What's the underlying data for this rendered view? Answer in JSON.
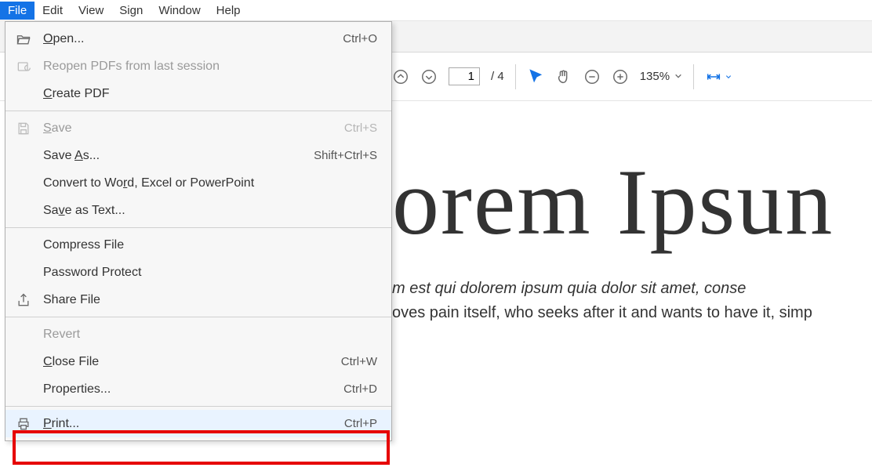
{
  "menubar": {
    "file": "File",
    "edit": "Edit",
    "view": "View",
    "sign": "Sign",
    "window": "Window",
    "help": "Help"
  },
  "toolbar": {
    "page_current": "1",
    "page_total": "/ 4",
    "zoom_label": "135%"
  },
  "file_menu": {
    "open": {
      "label": "Open...",
      "shortcut": "Ctrl+O"
    },
    "reopen": {
      "label": "Reopen PDFs from last session",
      "shortcut": ""
    },
    "create_pdf": {
      "label": "Create PDF",
      "shortcut": ""
    },
    "save": {
      "label": "Save",
      "shortcut": "Ctrl+S"
    },
    "save_as": {
      "label": "Save As...",
      "shortcut": "Shift+Ctrl+S"
    },
    "convert": {
      "label": "Convert to Word, Excel or PowerPoint",
      "shortcut": ""
    },
    "save_text": {
      "label": "Save as Text...",
      "shortcut": ""
    },
    "compress": {
      "label": "Compress File",
      "shortcut": ""
    },
    "password": {
      "label": "Password Protect",
      "shortcut": ""
    },
    "share": {
      "label": "Share File",
      "shortcut": ""
    },
    "revert": {
      "label": "Revert",
      "shortcut": ""
    },
    "close": {
      "label": "Close File",
      "shortcut": "Ctrl+W"
    },
    "properties": {
      "label": "Properties...",
      "shortcut": "Ctrl+D"
    },
    "print": {
      "label": "Print...",
      "shortcut": "Ctrl+P"
    }
  },
  "document": {
    "title": "orem Ipsun",
    "line1": "m est qui dolorem ipsum quia dolor sit amet, conse",
    "line2": "oves pain itself, who seeks after it and wants to have it, simp"
  }
}
